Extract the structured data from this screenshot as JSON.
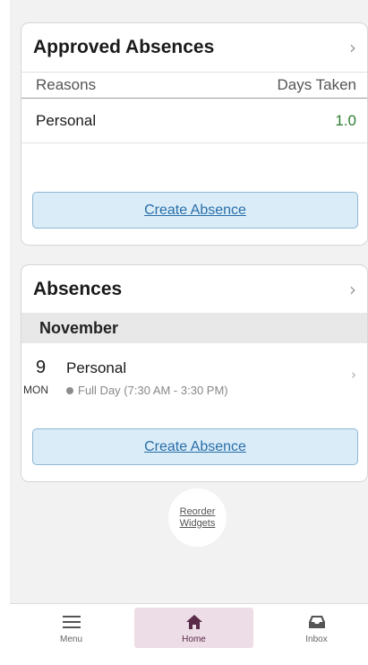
{
  "approved_card": {
    "title": "Approved Absences",
    "col_reasons": "Reasons",
    "col_days": "Days Taken",
    "rows": [
      {
        "reason": "Personal",
        "days": "1.0"
      }
    ],
    "create_label": "Create Absence"
  },
  "absences_card": {
    "title": "Absences",
    "month": "November",
    "items": [
      {
        "day": "9",
        "weekday": "MON",
        "type": "Personal",
        "detail": "Full Day (7:30 AM - 3:30 PM)"
      }
    ],
    "create_label": "Create Absence"
  },
  "reorder": {
    "line1": "Reorder",
    "line2": "Widgets"
  },
  "tabs": [
    {
      "label": "Menu",
      "icon": "menu-icon"
    },
    {
      "label": "Home",
      "icon": "home-icon",
      "active": true
    },
    {
      "label": "Inbox",
      "icon": "inbox-icon"
    }
  ],
  "colors": {
    "accent": "#5b2c4a",
    "days_value": "#2e7d32",
    "button_bg": "#d9ecf8",
    "link": "#2a6ea8"
  }
}
